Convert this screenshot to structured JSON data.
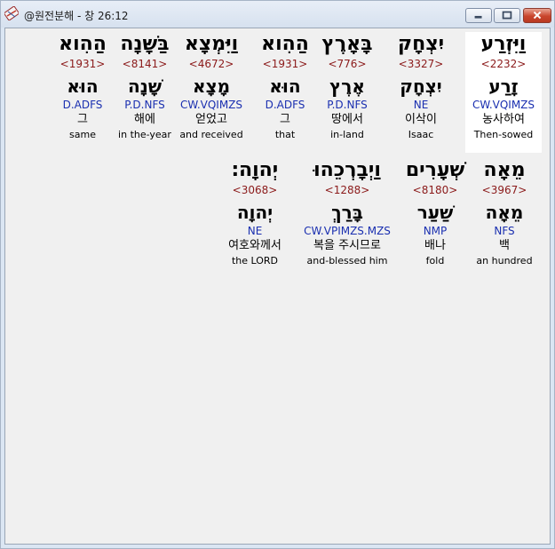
{
  "window": {
    "title": "@원전분해 - 창 26:12",
    "icons": [
      "app-icon",
      "minimize-icon",
      "maximize-icon",
      "close-icon"
    ]
  },
  "rows": [
    {
      "words": [
        {
          "heb": "וַיִּזְרַע",
          "strong": "<2232>",
          "lemma": "זָרַע",
          "morph": "CW.VQIMZS",
          "kor": "농사하여",
          "eng": "Then-sowed",
          "selected": true
        },
        {
          "heb": "יִצְחָק",
          "strong": "<3327>",
          "lemma": "יִצְחָק",
          "morph": "NE",
          "kor": "이삭이",
          "eng": "Isaac"
        },
        {
          "heb": "בָּאָרֶץ",
          "strong": "<776>",
          "lemma": "אֶרֶץ",
          "morph": "P.D.NFS",
          "kor": "땅에서",
          "eng": "in-land"
        },
        {
          "heb": "הַהִוא",
          "strong": "<1931>",
          "lemma": "הוּא",
          "morph": "D.ADFS",
          "kor": "그",
          "eng": "that"
        },
        {
          "heb": "וַיִּמְצָא",
          "strong": "<4672>",
          "lemma": "מָצָא",
          "morph": "CW.VQIMZS",
          "kor": "얻었고",
          "eng": "and received"
        },
        {
          "heb": "בַּשָּׁנָה",
          "strong": "<8141>",
          "lemma": "שָׁנָה",
          "morph": "P.D.NFS",
          "kor": "해에",
          "eng": "in the-year"
        },
        {
          "heb": "הַהִוא",
          "strong": "<1931>",
          "lemma": "הוּא",
          "morph": "D.ADFS",
          "kor": "그",
          "eng": "same"
        }
      ]
    },
    {
      "words": [
        {
          "heb": "מֵאָה",
          "strong": "<3967>",
          "lemma": "מֵאָה",
          "morph": "NFS",
          "kor": "백",
          "eng": "an hundred"
        },
        {
          "heb": "שְׁעָרִים",
          "strong": "<8180>",
          "lemma": "שַׁעַר",
          "morph": "NMP",
          "kor": "배나",
          "eng": "fold"
        },
        {
          "heb": "וַיְבָרְכֵהוּ",
          "strong": "<1288>",
          "lemma": "בָּרַךְ",
          "morph": "CW.VPIMZS.MZS",
          "kor": "복을 주시므로",
          "eng": "and-blessed him"
        },
        {
          "heb": "יְהוָה׃",
          "strong": "<3068>",
          "lemma": "יְהוָה",
          "morph": "NE",
          "kor": "여호와께서",
          "eng": "the LORD"
        }
      ]
    }
  ]
}
